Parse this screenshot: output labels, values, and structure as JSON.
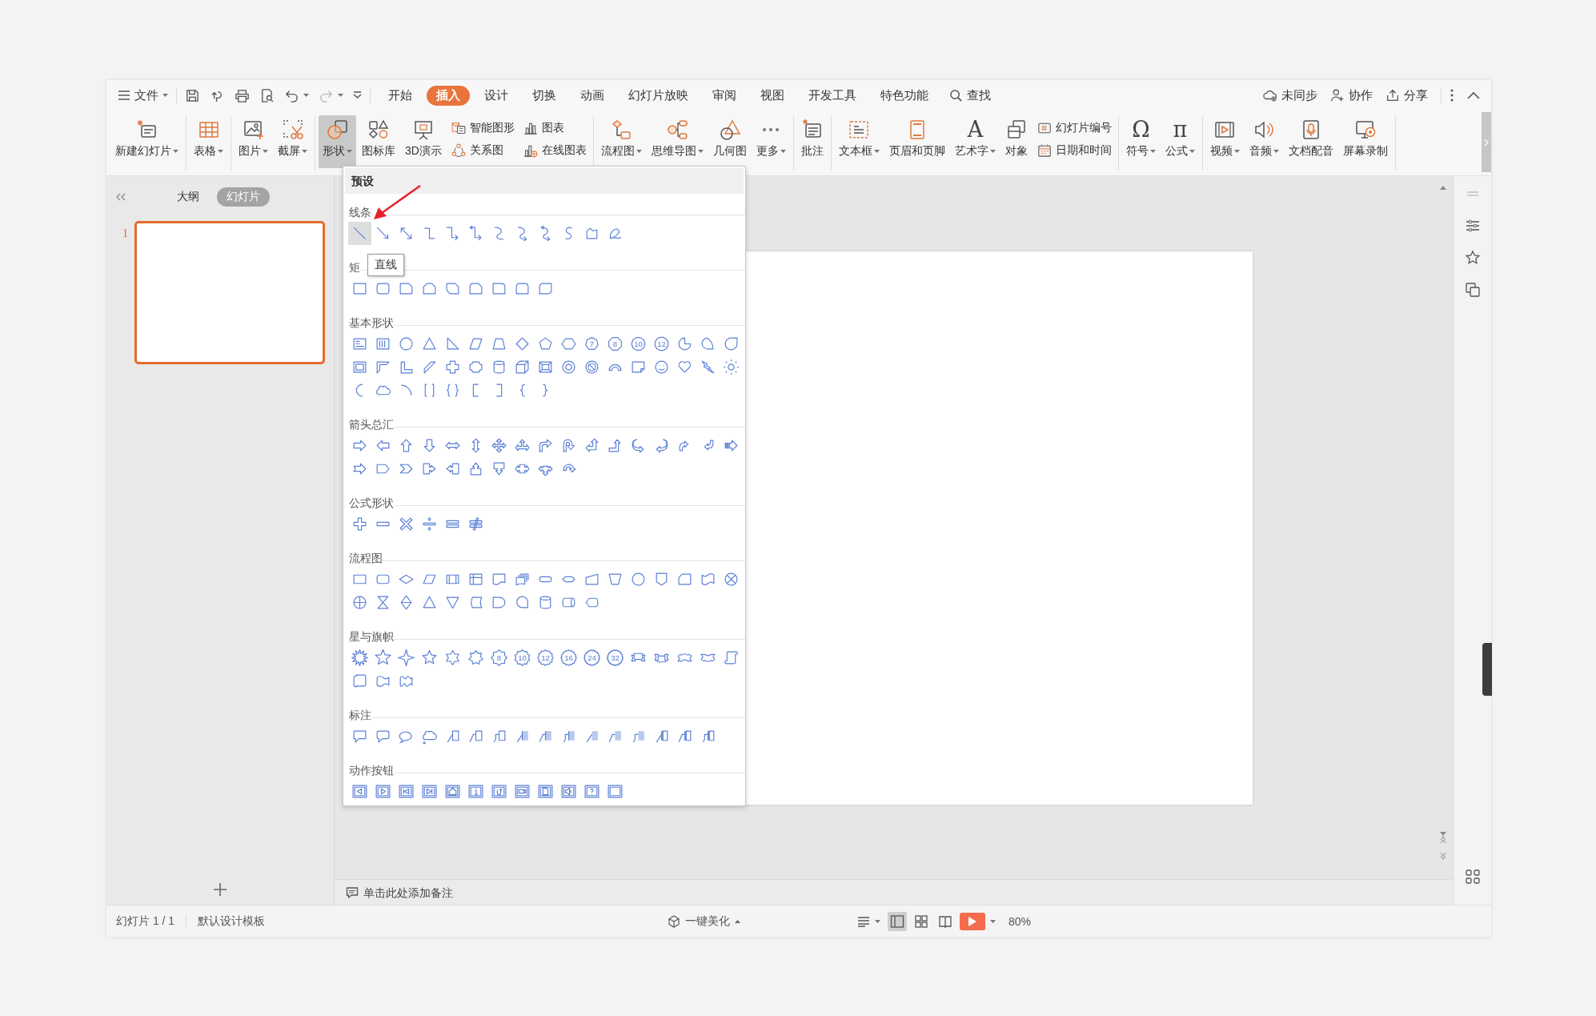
{
  "menu_bar": {
    "file_menu": {
      "label": "文件"
    },
    "tabs": [
      {
        "label": "开始",
        "selected": false
      },
      {
        "label": "插入",
        "selected": true
      },
      {
        "label": "设计",
        "selected": false
      },
      {
        "label": "切换",
        "selected": false
      },
      {
        "label": "动画",
        "selected": false
      },
      {
        "label": "幻灯片放映",
        "selected": false
      },
      {
        "label": "审阅",
        "selected": false
      },
      {
        "label": "视图",
        "selected": false
      },
      {
        "label": "开发工具",
        "selected": false
      },
      {
        "label": "特色功能",
        "selected": false
      }
    ],
    "search": {
      "label": "查找"
    },
    "actions": [
      {
        "label": "未同步"
      },
      {
        "label": "协作"
      },
      {
        "label": "分享"
      }
    ]
  },
  "ribbon": {
    "groups": [
      {
        "items": [
          {
            "kind": "large",
            "label": "新建幻灯片",
            "dropdown": true,
            "pressed": false
          }
        ]
      },
      {
        "items": [
          {
            "kind": "large",
            "label": "表格",
            "dropdown": true,
            "pressed": false
          }
        ]
      },
      {
        "items": [
          {
            "kind": "large",
            "label": "图片",
            "dropdown": true,
            "pressed": false
          },
          {
            "kind": "large",
            "label": "截屏",
            "dropdown": true,
            "pressed": false
          }
        ]
      },
      {
        "items": [
          {
            "kind": "large",
            "label": "形状",
            "dropdown": true,
            "pressed": true
          },
          {
            "kind": "large",
            "label": "图标库",
            "dropdown": false,
            "pressed": false
          },
          {
            "kind": "large",
            "label": "3D演示",
            "dropdown": false,
            "pressed": false
          },
          {
            "kind": "stack",
            "items": [
              {
                "label": "智能图形"
              },
              {
                "label": "关系图"
              }
            ]
          },
          {
            "kind": "stack",
            "items": [
              {
                "label": "图表"
              },
              {
                "label": "在线图表"
              }
            ]
          }
        ]
      },
      {
        "items": [
          {
            "kind": "large",
            "label": "流程图",
            "dropdown": true,
            "pressed": false
          },
          {
            "kind": "large",
            "label": "思维导图",
            "dropdown": true,
            "pressed": false
          },
          {
            "kind": "large",
            "label": "几何图",
            "dropdown": false,
            "pressed": false
          },
          {
            "kind": "large",
            "label": "更多",
            "dropdown": true,
            "pressed": false
          }
        ]
      },
      {
        "items": [
          {
            "kind": "large",
            "label": "批注",
            "dropdown": false,
            "pressed": false
          }
        ]
      },
      {
        "items": [
          {
            "kind": "large",
            "label": "文本框",
            "dropdown": true,
            "pressed": false
          },
          {
            "kind": "large",
            "label": "页眉和页脚",
            "dropdown": false,
            "pressed": false
          },
          {
            "kind": "large",
            "label": "艺术字",
            "glyph": "A",
            "dropdown": true,
            "pressed": false
          },
          {
            "kind": "large",
            "label": "对象",
            "dropdown": false,
            "pressed": false
          },
          {
            "kind": "stack",
            "items": [
              {
                "label": "幻灯片编号"
              },
              {
                "label": "日期和时间"
              }
            ]
          }
        ]
      },
      {
        "items": [
          {
            "kind": "large",
            "label": "符号",
            "glyph": "Ω",
            "dropdown": true,
            "pressed": false
          },
          {
            "kind": "large",
            "label": "公式",
            "glyph": "π",
            "dropdown": true,
            "pressed": false
          }
        ]
      },
      {
        "items": [
          {
            "kind": "large",
            "label": "视频",
            "dropdown": true,
            "pressed": false
          },
          {
            "kind": "large",
            "label": "音频",
            "dropdown": true,
            "pressed": false
          },
          {
            "kind": "large",
            "label": "文档配音",
            "dropdown": false,
            "pressed": false
          },
          {
            "kind": "large",
            "label": "屏幕录制",
            "dropdown": false,
            "pressed": false
          }
        ]
      }
    ]
  },
  "slide_panel": {
    "tabs": [
      {
        "label": "大纲",
        "selected": false
      },
      {
        "label": "幻灯片",
        "selected": true
      }
    ],
    "slides": [
      {
        "number": "1",
        "selected": true
      }
    ]
  },
  "shapes_panel": {
    "title": "预设",
    "tooltip": "直线",
    "sections": [
      {
        "label": "线条",
        "shapes": [
          {
            "selected": true
          },
          {
            "selected": false
          },
          {
            "selected": false
          },
          {
            "selected": false
          },
          {
            "selected": false
          },
          {
            "selected": false
          },
          {
            "selected": false
          },
          {
            "selected": false
          },
          {
            "selected": false
          },
          {
            "selected": false
          },
          {
            "selected": false
          },
          {
            "selected": false
          }
        ]
      },
      {
        "label": "矩",
        "shapes": [
          {
            "selected": false
          },
          {
            "selected": false
          },
          {
            "selected": false
          },
          {
            "selected": false
          },
          {
            "selected": false
          },
          {
            "selected": false
          },
          {
            "selected": false
          },
          {
            "selected": false
          },
          {
            "selected": false
          }
        ]
      },
      {
        "label": "基本形状",
        "shapes": [
          {
            "selected": false
          },
          {
            "selected": false
          },
          {
            "selected": false
          },
          {
            "selected": false
          },
          {
            "selected": false
          },
          {
            "selected": false
          },
          {
            "selected": false
          },
          {
            "selected": false
          },
          {
            "selected": false
          },
          {
            "selected": false
          },
          {
            "selected": false,
            "label": "7"
          },
          {
            "selected": false,
            "label": "8"
          },
          {
            "selected": false,
            "label": "10"
          },
          {
            "selected": false,
            "label": "12"
          },
          {
            "selected": false
          },
          {
            "selected": false
          },
          {
            "selected": false
          },
          {
            "selected": false
          },
          {
            "selected": false
          },
          {
            "selected": false
          },
          {
            "selected": false
          },
          {
            "selected": false
          },
          {
            "selected": false
          },
          {
            "selected": false
          },
          {
            "selected": false
          },
          {
            "selected": false
          },
          {
            "selected": false
          },
          {
            "selected": false
          },
          {
            "selected": false
          },
          {
            "selected": false
          },
          {
            "selected": false
          },
          {
            "selected": false
          },
          {
            "selected": false
          },
          {
            "selected": false
          },
          {
            "selected": false
          },
          {
            "selected": false
          },
          {
            "selected": false
          },
          {
            "selected": false
          },
          {
            "selected": false
          },
          {
            "selected": false
          },
          {
            "selected": false
          },
          {
            "selected": false
          },
          {
            "selected": false
          }
        ]
      },
      {
        "label": "箭头总汇",
        "shapes": [
          {
            "selected": false
          },
          {
            "selected": false
          },
          {
            "selected": false
          },
          {
            "selected": false
          },
          {
            "selected": false
          },
          {
            "selected": false
          },
          {
            "selected": false
          },
          {
            "selected": false
          },
          {
            "selected": false
          },
          {
            "selected": false
          },
          {
            "selected": false
          },
          {
            "selected": false
          },
          {
            "selected": false
          },
          {
            "selected": false
          },
          {
            "selected": false
          },
          {
            "selected": false
          },
          {
            "selected": false
          },
          {
            "selected": false
          },
          {
            "selected": false
          },
          {
            "selected": false
          },
          {
            "selected": false
          },
          {
            "selected": false
          },
          {
            "selected": false
          },
          {
            "selected": false
          },
          {
            "selected": false
          },
          {
            "selected": false
          },
          {
            "selected": false
          }
        ]
      },
      {
        "label": "公式形状",
        "shapes": [
          {
            "selected": false
          },
          {
            "selected": false
          },
          {
            "selected": false
          },
          {
            "selected": false
          },
          {
            "selected": false
          },
          {
            "selected": false
          }
        ]
      },
      {
        "label": "流程图",
        "shapes": [
          {
            "selected": false
          },
          {
            "selected": false
          },
          {
            "selected": false
          },
          {
            "selected": false
          },
          {
            "selected": false
          },
          {
            "selected": false
          },
          {
            "selected": false
          },
          {
            "selected": false
          },
          {
            "selected": false
          },
          {
            "selected": false
          },
          {
            "selected": false
          },
          {
            "selected": false
          },
          {
            "selected": false
          },
          {
            "selected": false
          },
          {
            "selected": false
          },
          {
            "selected": false
          },
          {
            "selected": false
          },
          {
            "selected": false
          },
          {
            "selected": false
          },
          {
            "selected": false
          },
          {
            "selected": false
          },
          {
            "selected": false
          },
          {
            "selected": false
          },
          {
            "selected": false
          },
          {
            "selected": false
          },
          {
            "selected": false
          },
          {
            "selected": false
          },
          {
            "selected": false
          }
        ]
      },
      {
        "label": "星与旗帜",
        "shapes": [
          {
            "selected": false
          },
          {
            "selected": false
          },
          {
            "selected": false
          },
          {
            "selected": false
          },
          {
            "selected": false
          },
          {
            "selected": false
          },
          {
            "selected": false,
            "label": "8"
          },
          {
            "selected": false,
            "label": "10"
          },
          {
            "selected": false,
            "label": "12"
          },
          {
            "selected": false,
            "label": "16"
          },
          {
            "selected": false,
            "label": "24"
          },
          {
            "selected": false,
            "label": "32"
          },
          {
            "selected": false
          },
          {
            "selected": false
          },
          {
            "selected": false
          },
          {
            "selected": false
          },
          {
            "selected": false
          },
          {
            "selected": false
          },
          {
            "selected": false
          },
          {
            "selected": false
          }
        ]
      },
      {
        "label": "标注",
        "shapes": [
          {
            "selected": false
          },
          {
            "selected": false
          },
          {
            "selected": false
          },
          {
            "selected": false
          },
          {
            "selected": false
          },
          {
            "selected": false
          },
          {
            "selected": false
          },
          {
            "selected": false
          },
          {
            "selected": false
          },
          {
            "selected": false
          },
          {
            "selected": false
          },
          {
            "selected": false
          },
          {
            "selected": false
          },
          {
            "selected": false
          },
          {
            "selected": false
          },
          {
            "selected": false
          }
        ]
      },
      {
        "label": "动作按钮",
        "shapes": [
          {
            "selected": false
          },
          {
            "selected": false
          },
          {
            "selected": false
          },
          {
            "selected": false
          },
          {
            "selected": false
          },
          {
            "selected": false
          },
          {
            "selected": false
          },
          {
            "selected": false
          },
          {
            "selected": false
          },
          {
            "selected": false
          },
          {
            "selected": false
          },
          {
            "selected": false
          }
        ]
      }
    ]
  },
  "notes": {
    "placeholder": "单击此处添加备注"
  },
  "status_bar": {
    "slide_info": "幻灯片 1 / 1",
    "template": "默认设计模板",
    "beautify": "一键美化",
    "views": [
      {
        "selected": true
      },
      {
        "selected": false
      },
      {
        "selected": false
      }
    ],
    "zoom": "80%"
  }
}
